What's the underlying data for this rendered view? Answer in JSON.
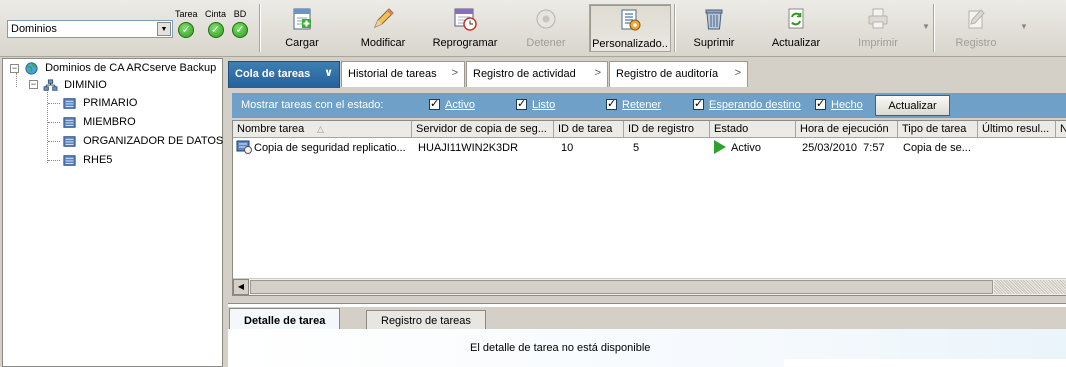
{
  "toolbar": {
    "domain_select": "Dominios",
    "status": {
      "task_label": "Tarea",
      "tape_label": "Cinta",
      "db_label": "BD"
    },
    "buttons": {
      "load": "Cargar",
      "modify": "Modificar",
      "reschedule": "Reprogramar",
      "stop": "Detener",
      "customized": "Personalizado..",
      "delete": "Suprimir",
      "refresh": "Actualizar",
      "print": "Imprimir",
      "log": "Registro"
    }
  },
  "tree": {
    "root": "Dominios de CA ARCserve Backup",
    "domain": "DIMINIO",
    "servers": [
      "PRIMARIO",
      "MIEMBRO",
      "ORGANIZADOR DE DATOS",
      "RHE5"
    ]
  },
  "tabs": {
    "job_queue": "Cola de tareas",
    "job_history": "Historial de tareas",
    "activity_log": "Registro de actividad",
    "audit_log": "Registro de auditoría"
  },
  "filter": {
    "label": "Mostrar tareas con el estado:",
    "active": "Activo",
    "ready": "Listo",
    "hold": "Retener",
    "waiting": "Esperando destino",
    "done": "Hecho",
    "update_button": "Actualizar"
  },
  "grid": {
    "headers": {
      "name": "Nombre tarea",
      "server": "Servidor de copia de seg...",
      "job_id": "ID de tarea",
      "log_id": "ID de registro",
      "status": "Estado",
      "exec_time": "Hora de ejecución",
      "type": "Tipo de tarea",
      "last_result": "Último resul...",
      "extra": "N"
    },
    "rows": [
      {
        "name": "Copia de seguridad replicatio...",
        "server": "HUAJI11WIN2K3DR",
        "job_id": "10",
        "log_id": "5",
        "status": "Activo",
        "exec_time": "25/03/2010  7:57",
        "type": "Copia de se..."
      }
    ]
  },
  "bottom": {
    "tab_detail": "Detalle de tarea",
    "tab_log": "Registro de tareas",
    "message": "El detalle de tarea no está disponible"
  }
}
